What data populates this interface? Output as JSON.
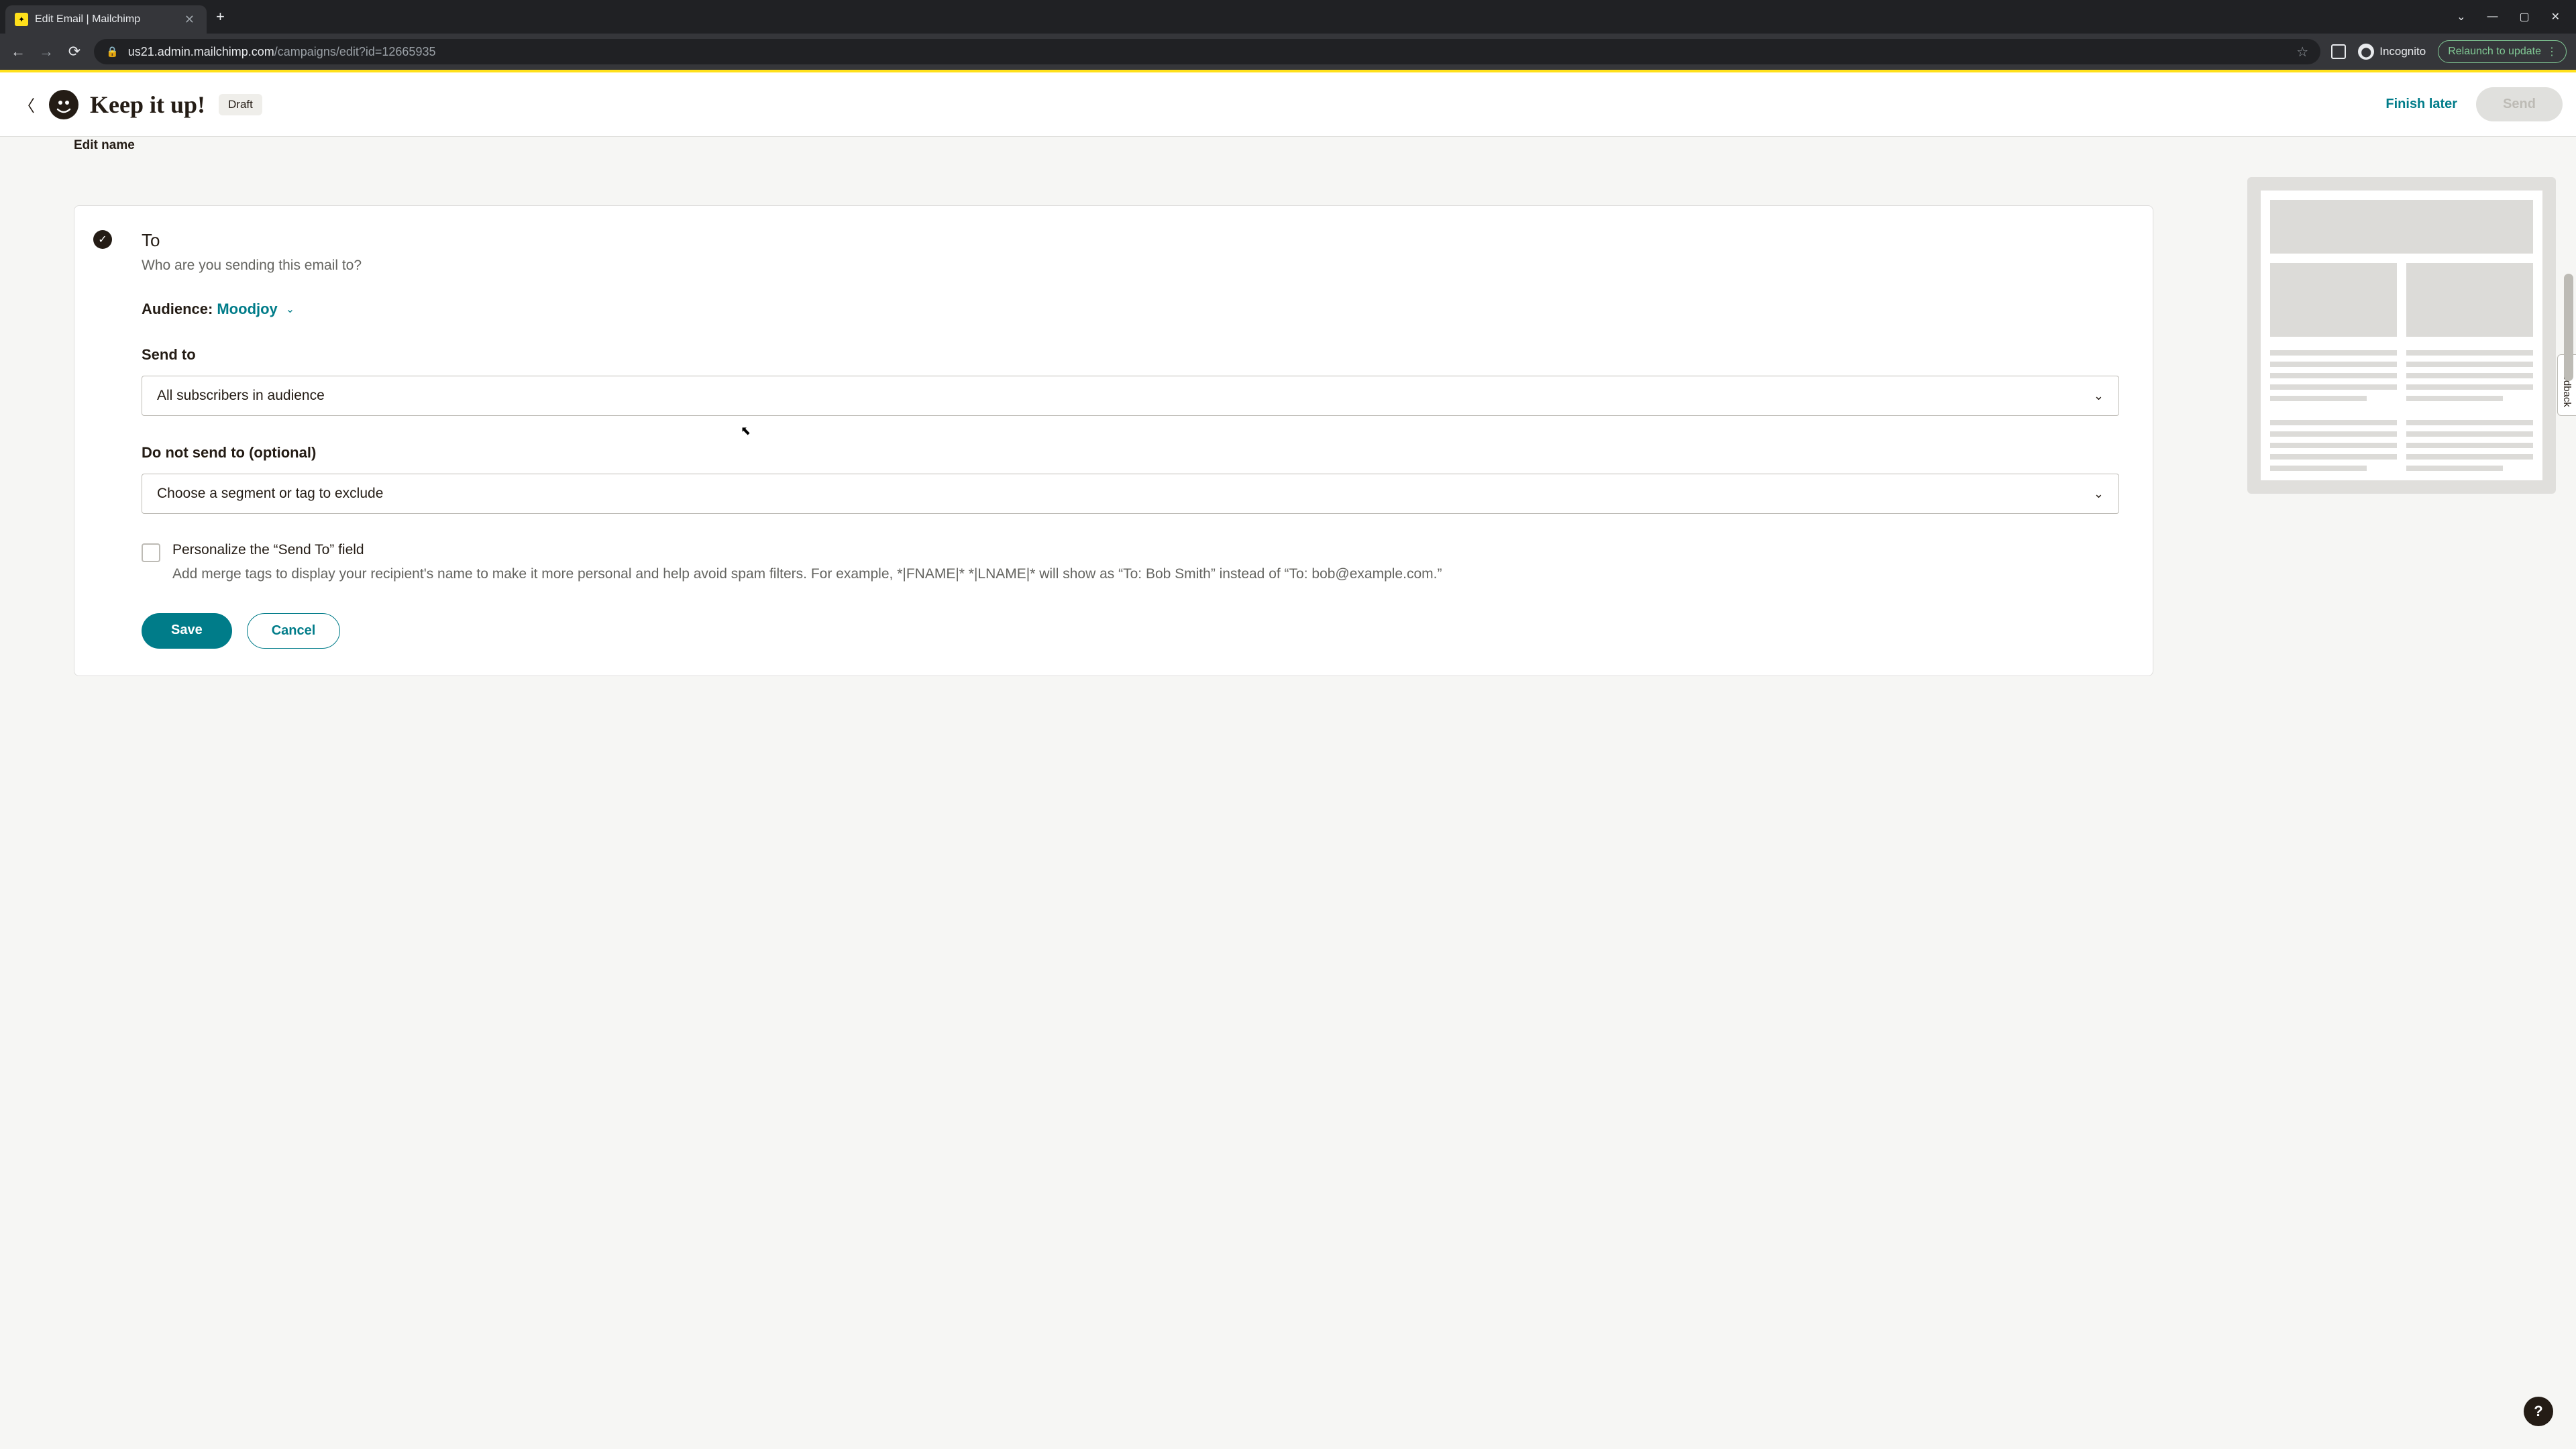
{
  "browser": {
    "tab_title": "Edit Email | Mailchimp",
    "url_domain": "us21.admin.mailchimp.com",
    "url_path": "/campaigns/edit?id=12665935",
    "incognito_label": "Incognito",
    "relaunch_label": "Relaunch to update"
  },
  "header": {
    "campaign_title": "Keep it up!",
    "status_badge": "Draft",
    "finish_later": "Finish later",
    "send": "Send"
  },
  "page": {
    "edit_name": "Edit name"
  },
  "to_card": {
    "title": "To",
    "subtitle": "Who are you sending this email to?",
    "audience_label": "Audience:",
    "audience_value": "Moodjoy",
    "send_to_label": "Send to",
    "send_to_value": "All subscribers in audience",
    "exclude_label": "Do not send to (optional)",
    "exclude_value": "Choose a segment or tag to exclude",
    "personalize_label": "Personalize the “Send To” field",
    "personalize_desc": "Add merge tags to display your recipient's name to make it more personal and help avoid spam filters. For example, *|FNAME|* *|LNAME|* will show as “To: Bob Smith” instead of “To: bob@example.com.”",
    "save": "Save",
    "cancel": "Cancel"
  },
  "feedback": "Feedback",
  "help": "?"
}
